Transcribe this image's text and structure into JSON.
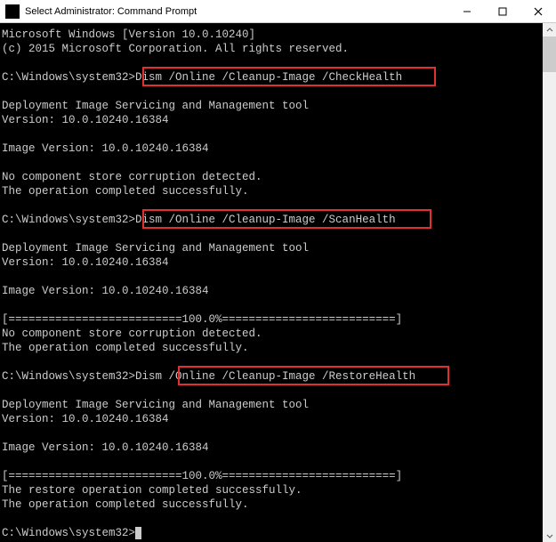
{
  "window": {
    "title": "Select Administrator: Command Prompt"
  },
  "lines": {
    "header1": "Microsoft Windows [Version 10.0.10240]",
    "header2": "(c) 2015 Microsoft Corporation. All rights reserved.",
    "prompt1": "C:\\Windows\\system32>Dism /Online /Cleanup-Image /CheckHealth",
    "tool_line": "Deployment Image Servicing and Management tool",
    "version_line": "Version: 10.0.10240.16384",
    "image_version": "Image Version: 10.0.10240.16384",
    "no_corruption": "No component store corruption detected.",
    "op_success": "The operation completed successfully.",
    "prompt2": "C:\\Windows\\system32>Dism /Online /Cleanup-Image /ScanHealth",
    "progress": "[==========================100.0%==========================]",
    "prompt3": "C:\\Windows\\system32>Dism /Online /Cleanup-Image /RestoreHealth",
    "restore_success": "The restore operation completed successfully.",
    "prompt_final": "C:\\Windows\\system32>"
  }
}
